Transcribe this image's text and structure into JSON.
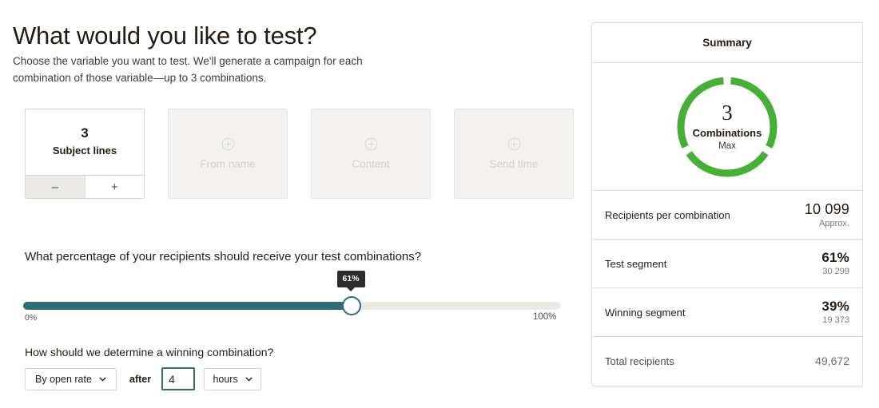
{
  "header": {
    "title": "What would you like to test?",
    "subtitle": "Choose the variable you want to test. We'll generate a campaign for each combination of those variable—up to 3 combinations."
  },
  "variables": {
    "active": {
      "count": "3",
      "label": "Subject lines",
      "decrement_label": "–",
      "increment_label": "+"
    },
    "disabled": [
      {
        "label": "From name",
        "icon": "plus-circle-icon"
      },
      {
        "label": "Content",
        "icon": "plus-circle-icon"
      },
      {
        "label": "Send time",
        "icon": "plus-circle-icon"
      }
    ]
  },
  "slider": {
    "question": "What percentage of your recipients should receive your test combinations?",
    "value": 61,
    "tooltip": "61%",
    "min_label": "0%",
    "max_label": "100%",
    "fill_color": "#2b6f75",
    "track_color": "#eceae4"
  },
  "winner": {
    "question": "How should we determine a winning combination?",
    "criteria_value": "By open rate",
    "after_label": "after",
    "duration_value": "4",
    "unit_value": "hours"
  },
  "summary": {
    "title": "Summary",
    "donut": {
      "value": "3",
      "label": "Combinations",
      "sublabel": "Max",
      "segments": 3,
      "color": "#45b035"
    },
    "rows": [
      {
        "label": "Recipients per combination",
        "value": "10 099",
        "sub": "Approx.",
        "bold": false
      },
      {
        "label": "Test segment",
        "value": "61%",
        "sub": "30 299",
        "bold": true
      },
      {
        "label": "Winning segment",
        "value": "39%",
        "sub": "19 373",
        "bold": true
      },
      {
        "label": "Total recipients",
        "value": "49,672",
        "sub": "",
        "bold": false
      }
    ]
  }
}
